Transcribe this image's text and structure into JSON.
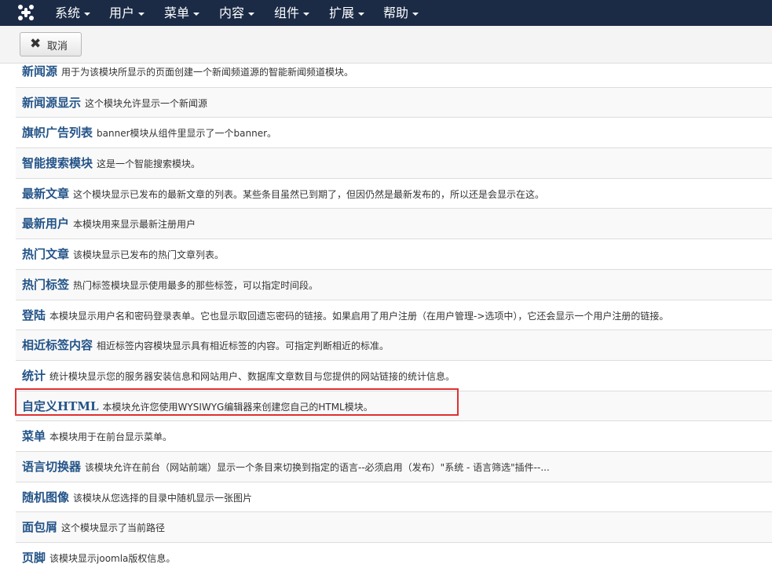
{
  "nav": {
    "menus": [
      {
        "label": "系统"
      },
      {
        "label": "用户"
      },
      {
        "label": "菜单"
      },
      {
        "label": "内容"
      },
      {
        "label": "组件"
      },
      {
        "label": "扩展"
      },
      {
        "label": "帮助"
      }
    ]
  },
  "toolbar": {
    "cancel_label": "取消"
  },
  "modules": [
    {
      "name": "新闻源",
      "desc": "用于为该模块所显示的页面创建一个新闻频道源的智能新闻频道模块。"
    },
    {
      "name": "新闻源显示",
      "desc": "这个模块允许显示一个新闻源"
    },
    {
      "name": "旗帜广告列表",
      "desc": "banner模块从组件里显示了一个banner。"
    },
    {
      "name": "智能搜索模块",
      "desc": "这是一个智能搜索模块。"
    },
    {
      "name": "最新文章",
      "desc": "这个模块显示已发布的最新文章的列表。某些条目虽然已到期了，但因仍然是最新发布的，所以还是会显示在这。"
    },
    {
      "name": "最新用户",
      "desc": "本模块用来显示最新注册用户"
    },
    {
      "name": "热门文章",
      "desc": "该模块显示已发布的热门文章列表。"
    },
    {
      "name": "热门标签",
      "desc": "热门标签模块显示使用最多的那些标签，可以指定时间段。"
    },
    {
      "name": "登陆",
      "desc": "本模块显示用户名和密码登录表单。它也显示取回遗忘密码的链接。如果启用了用户注册（在用户管理->选项中），它还会显示一个用户注册的链接。"
    },
    {
      "name": "相近标签内容",
      "desc": "相近标签内容模块显示具有相近标签的内容。可指定判断相近的标准。"
    },
    {
      "name": "统计",
      "desc": "统计模块显示您的服务器安装信息和网站用户、数据库文章数目与您提供的网站链接的统计信息。"
    },
    {
      "name": "自定义HTML",
      "desc": "本模块允许您使用WYSIWYG编辑器来创建您自己的HTML模块。"
    },
    {
      "name": "菜单",
      "desc": "本模块用于在前台显示菜单。"
    },
    {
      "name": "语言切换器",
      "desc": "该模块允许在前台（网站前端）显示一个条目来切换到指定的语言--必须启用（发布）\"系统 - 语言筛选\"插件--..."
    },
    {
      "name": "随机图像",
      "desc": "该模块从您选择的目录中随机显示一张图片"
    },
    {
      "name": "面包屑",
      "desc": "这个模块显示了当前路径"
    },
    {
      "name": "页脚",
      "desc": "该模块显示joomla版权信息。"
    }
  ]
}
